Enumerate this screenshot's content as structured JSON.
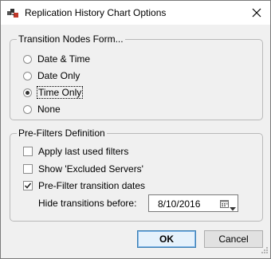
{
  "window": {
    "title": "Replication History Chart Options"
  },
  "transition_group": {
    "legend": "Transition Nodes Form...",
    "options": [
      {
        "label": "Date & Time",
        "checked": false
      },
      {
        "label": "Date Only",
        "checked": false
      },
      {
        "label": "Time Only",
        "checked": true
      },
      {
        "label": "None",
        "checked": false
      }
    ]
  },
  "prefilter_group": {
    "legend": "Pre-Filters Definition",
    "checkboxes": [
      {
        "label": "Apply last used filters",
        "checked": false
      },
      {
        "label": "Show 'Excluded Servers'",
        "checked": false
      },
      {
        "label": "Pre-Filter transition dates",
        "checked": true
      }
    ],
    "hide_label": "Hide transitions before:",
    "date_value": "8/10/2016"
  },
  "buttons": {
    "ok": "OK",
    "cancel": "Cancel"
  }
}
